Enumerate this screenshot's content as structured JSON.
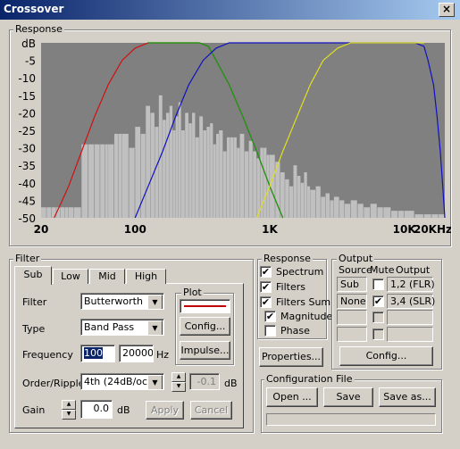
{
  "window": {
    "title": "Crossover",
    "close_glyph": "×"
  },
  "response_group": {
    "label": "Response"
  },
  "chart_data": {
    "type": "line",
    "x_scale": "log",
    "xlim": [
      20,
      20000
    ],
    "ylim": [
      -50,
      0
    ],
    "y_ticks": [
      "dB",
      "-5",
      "-10",
      "-15",
      "-20",
      "-25",
      "-30",
      "-35",
      "-40",
      "-45",
      "-50"
    ],
    "y_tick_values": [
      0,
      -5,
      -10,
      -15,
      -20,
      -25,
      -30,
      -35,
      -40,
      -45,
      -50
    ],
    "x_ticks": [
      "20",
      "100",
      "1K",
      "10K",
      "20KHz"
    ],
    "x_tick_values": [
      20,
      100,
      1000,
      10000,
      20000
    ],
    "plot_background": "#808080",
    "spectrum_color": "#c0c0c0",
    "spectrum": [
      [
        20,
        -47
      ],
      [
        22,
        -47
      ],
      [
        24,
        -47
      ],
      [
        26,
        -47
      ],
      [
        28,
        -47
      ],
      [
        30,
        -47
      ],
      [
        32,
        -47
      ],
      [
        35,
        -47
      ],
      [
        40,
        -29
      ],
      [
        45,
        -29
      ],
      [
        50,
        -29
      ],
      [
        55,
        -29
      ],
      [
        60,
        -29
      ],
      [
        63,
        -29
      ],
      [
        70,
        -26
      ],
      [
        75,
        -26
      ],
      [
        80,
        -26
      ],
      [
        90,
        -30
      ],
      [
        100,
        -24
      ],
      [
        110,
        -26
      ],
      [
        120,
        -18
      ],
      [
        130,
        -20
      ],
      [
        140,
        -24
      ],
      [
        150,
        -15
      ],
      [
        160,
        -22
      ],
      [
        170,
        -20
      ],
      [
        180,
        -18
      ],
      [
        190,
        -25
      ],
      [
        200,
        -21
      ],
      [
        210,
        -17
      ],
      [
        220,
        -25
      ],
      [
        235,
        -20
      ],
      [
        250,
        -23
      ],
      [
        265,
        -20
      ],
      [
        280,
        -27
      ],
      [
        300,
        -21
      ],
      [
        320,
        -25
      ],
      [
        340,
        -24
      ],
      [
        360,
        -23
      ],
      [
        380,
        -29
      ],
      [
        400,
        -26
      ],
      [
        420,
        -25
      ],
      [
        450,
        -31
      ],
      [
        480,
        -27
      ],
      [
        510,
        -27
      ],
      [
        540,
        -27
      ],
      [
        570,
        -30
      ],
      [
        600,
        -26
      ],
      [
        650,
        -31
      ],
      [
        700,
        -28
      ],
      [
        750,
        -31
      ],
      [
        800,
        -33
      ],
      [
        850,
        -30
      ],
      [
        900,
        -30
      ],
      [
        950,
        -32
      ],
      [
        1000,
        -32
      ],
      [
        1100,
        -34
      ],
      [
        1200,
        -37
      ],
      [
        1300,
        -39
      ],
      [
        1400,
        -41
      ],
      [
        1500,
        -35
      ],
      [
        1600,
        -38
      ],
      [
        1700,
        -40
      ],
      [
        1800,
        -37
      ],
      [
        1900,
        -41
      ],
      [
        2000,
        -42
      ],
      [
        2200,
        -41
      ],
      [
        2400,
        -44
      ],
      [
        2600,
        -43
      ],
      [
        2800,
        -45
      ],
      [
        3000,
        -44
      ],
      [
        3300,
        -45
      ],
      [
        3600,
        -46
      ],
      [
        4000,
        -45
      ],
      [
        4500,
        -46
      ],
      [
        5000,
        -47
      ],
      [
        5600,
        -46
      ],
      [
        6300,
        -47
      ],
      [
        7000,
        -47
      ],
      [
        8000,
        -48
      ],
      [
        9000,
        -48
      ],
      [
        10000,
        -48
      ],
      [
        12000,
        -49
      ],
      [
        14000,
        -49
      ],
      [
        16000,
        -49
      ],
      [
        18000,
        -49
      ],
      [
        20000,
        -50
      ]
    ],
    "series": [
      {
        "color": "#d01010",
        "points": [
          [
            25,
            -50
          ],
          [
            28,
            -46
          ],
          [
            32,
            -41
          ],
          [
            40,
            -31
          ],
          [
            50,
            -21
          ],
          [
            63,
            -12
          ],
          [
            80,
            -5
          ],
          [
            100,
            -1.5
          ],
          [
            125,
            0
          ],
          [
            160,
            0
          ],
          [
            200,
            0
          ],
          [
            250,
            0
          ],
          [
            300,
            0
          ],
          [
            350,
            -1
          ],
          [
            400,
            -5
          ],
          [
            500,
            -12
          ],
          [
            630,
            -21
          ],
          [
            800,
            -31
          ],
          [
            1000,
            -41
          ],
          [
            1250,
            -50
          ]
        ]
      },
      {
        "color": "#10a010",
        "points": [
          [
            125,
            0
          ],
          [
            160,
            0
          ],
          [
            200,
            0
          ],
          [
            250,
            0
          ],
          [
            300,
            0
          ],
          [
            350,
            -1
          ],
          [
            400,
            -5
          ],
          [
            500,
            -12
          ],
          [
            630,
            -21
          ],
          [
            800,
            -31
          ],
          [
            1000,
            -41
          ],
          [
            1250,
            -50
          ]
        ]
      },
      {
        "color": "#1010c0",
        "points": [
          [
            100,
            -50
          ],
          [
            125,
            -41
          ],
          [
            160,
            -31
          ],
          [
            200,
            -21
          ],
          [
            250,
            -12
          ],
          [
            320,
            -5
          ],
          [
            400,
            -1.5
          ],
          [
            500,
            0
          ],
          [
            1000,
            0
          ],
          [
            2000,
            0
          ],
          [
            4000,
            0
          ],
          [
            8000,
            0
          ],
          [
            12000,
            0
          ],
          [
            14000,
            -1
          ],
          [
            15000,
            -5
          ],
          [
            16500,
            -12
          ],
          [
            17500,
            -21
          ],
          [
            18500,
            -31
          ],
          [
            19300,
            -41
          ],
          [
            20000,
            -50
          ]
        ]
      },
      {
        "color": "#e0e020",
        "points": [
          [
            800,
            -50
          ],
          [
            1000,
            -41
          ],
          [
            1250,
            -31
          ],
          [
            1600,
            -21
          ],
          [
            2000,
            -12
          ],
          [
            2500,
            -5
          ],
          [
            3200,
            -1.5
          ],
          [
            4000,
            0
          ],
          [
            8000,
            0
          ],
          [
            14000,
            0
          ]
        ]
      }
    ],
    "legend": "none"
  },
  "filter_group": {
    "label": "Filter",
    "tabs": [
      "Sub",
      "Low",
      "Mid",
      "High"
    ],
    "filter_label": "Filter",
    "filter_value": "Butterworth",
    "type_label": "Type",
    "type_value": "Band Pass",
    "frequency_label": "Frequency",
    "freq_low": "100",
    "freq_high": "20000",
    "hz_unit": "Hz",
    "order_label": "Order/Ripple",
    "order_value": "4th (24dB/oct)",
    "ripple_value": "-0.1",
    "ripple_unit": "dB",
    "gain_label": "Gain",
    "gain_value": "0.0",
    "gain_unit": "dB",
    "apply_label": "Apply",
    "cancel_label": "Cancel",
    "plot_label": "Plot",
    "plot_color": "#c00000",
    "config_label": "Config...",
    "impulse_label": "Impulse..."
  },
  "response_panel": {
    "label": "Response",
    "items": [
      {
        "label": "Spectrum",
        "checked": "✔"
      },
      {
        "label": "Filters",
        "checked": "✔"
      },
      {
        "label": "Filters Sum",
        "checked": "✔"
      },
      {
        "label": "Magnitude",
        "checked": "✔"
      },
      {
        "label": "Phase",
        "checked": ""
      }
    ],
    "properties_label": "Properties..."
  },
  "output_panel": {
    "label": "Output",
    "headers": [
      "Source",
      "Mute",
      "Output"
    ],
    "rows": [
      {
        "source": "Sub",
        "mute": "",
        "output": "1,2 (FLR)"
      },
      {
        "source": "None",
        "mute": "✔",
        "output": "3,4 (SLR)"
      },
      {
        "source": "",
        "mute": "",
        "output": ""
      },
      {
        "source": "",
        "mute": "",
        "output": ""
      }
    ],
    "config_label": "Config..."
  },
  "config_file": {
    "label": "Configuration File",
    "open_label": "Open ...",
    "save_label": "Save",
    "save_as_label": "Save as..."
  }
}
